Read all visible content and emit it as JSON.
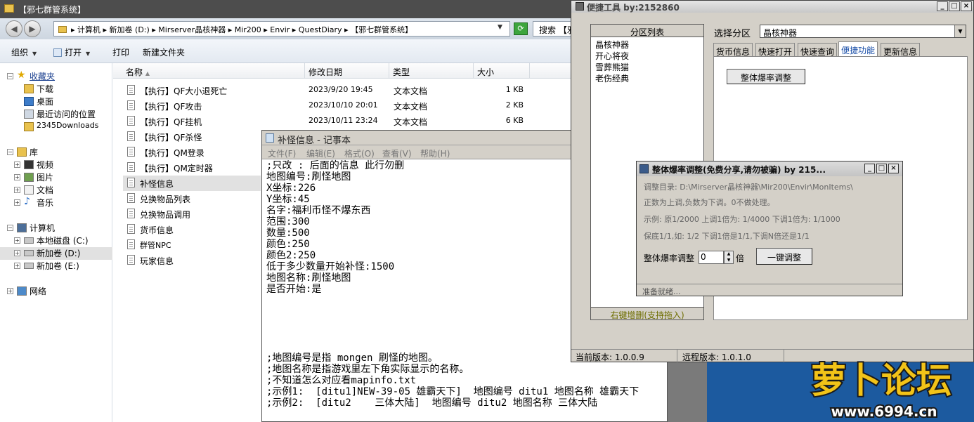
{
  "explorer": {
    "title": "【邪七群管系统】",
    "address": "▸ 计算机 ▸ 新加卷 (D:) ▸ Mirserver晶核神器 ▸ Mir200 ▸ Envir ▸ QuestDiary ▸ 【邪七群管系统】",
    "search_placeholder": "搜索 【邪",
    "toolbar": {
      "organize": "组织",
      "open": "打开",
      "print": "打印",
      "new_folder": "新建文件夹"
    },
    "nav": {
      "favorites": "收藏夹",
      "downloads": "下载",
      "desktop": "桌面",
      "recent": "最近访问的位置",
      "d2345": "2345Downloads",
      "library": "库",
      "video": "视频",
      "pictures": "图片",
      "documents": "文档",
      "music": "音乐",
      "computer": "计算机",
      "disk_c": "本地磁盘 (C:)",
      "disk_d": "新加卷 (D:)",
      "disk_e": "新加卷 (E:)",
      "network": "网络"
    },
    "columns": {
      "name": "名称",
      "date": "修改日期",
      "type": "类型",
      "size": "大小"
    },
    "files": [
      {
        "name": "【执行】QF大小退死亡",
        "date": "2023/9/20 19:45",
        "type": "文本文档",
        "size": "1 KB"
      },
      {
        "name": "【执行】QF攻击",
        "date": "2023/10/10 20:01",
        "type": "文本文档",
        "size": "2 KB"
      },
      {
        "name": "【执行】QF挂机",
        "date": "2023/10/11 23:24",
        "type": "文本文档",
        "size": "6 KB"
      },
      {
        "name": "【执行】QF杀怪",
        "date": "",
        "type": "",
        "size": ""
      },
      {
        "name": "【执行】QM登录",
        "date": "",
        "type": "",
        "size": ""
      },
      {
        "name": "【执行】QM定时器",
        "date": "",
        "type": "",
        "size": ""
      },
      {
        "name": "补怪信息",
        "date": "",
        "type": "",
        "size": ""
      },
      {
        "name": "兑换物品列表",
        "date": "",
        "type": "",
        "size": ""
      },
      {
        "name": "兑换物品调用",
        "date": "",
        "type": "",
        "size": ""
      },
      {
        "name": "货币信息",
        "date": "",
        "type": "",
        "size": ""
      },
      {
        "name": "群管NPC",
        "date": "",
        "type": "",
        "size": ""
      },
      {
        "name": "玩家信息",
        "date": "",
        "type": "",
        "size": ""
      }
    ]
  },
  "notepad": {
    "title": "补怪信息 - 记事本",
    "menu": [
      "文件(F)",
      "编辑(E)",
      "格式(O)",
      "查看(V)",
      "帮助(H)"
    ],
    "lines": [
      ";只改 : 后面的信息 此行勿删",
      "地图编号:刷怪地图",
      "X坐标:226",
      "Y坐标:45",
      "名字:福利币怪不爆东西",
      "范围:300",
      "数量:500",
      "颜色:250",
      "颜色2:250",
      "低于多少数量开始补怪:1500",
      "地图名称:刷怪地图",
      "是否开始:是"
    ],
    "notes": [
      ";地图编号是指 mongen 刷怪的地图。",
      ";地图名称是指游戏里左下角实际显示的名称。",
      ";不知道怎么对应看mapinfo.txt",
      ";示例1:  [ditu1]NEW-39-05 雄霸天下]  地图编号 ditu1 地图名称 雄霸天下",
      ";示例2:  [ditu2    三体大陆]  地图编号 ditu2 地图名称 三体大陆"
    ]
  },
  "tool": {
    "title": "便捷工具  by:2152860",
    "partition_header": "分区列表",
    "partitions": [
      "晶核神器",
      "开心将夜",
      "雪葬熊猫",
      "老伤经典"
    ],
    "partition_footer": "右键增删(支持拖入)",
    "select_label": "选择分区",
    "select_value": "晶核神器",
    "tabs": [
      "货币信息",
      "快速打开",
      "快速查询",
      "便捷功能",
      "更新信息"
    ],
    "active_tab": "便捷功能",
    "overall_button": "整体爆率调整",
    "current_version": "当前版本: 1.0.0.9",
    "remote_version": "远程版本: 1.0.1.0"
  },
  "dialog": {
    "title": "整体爆率调整(免费分享,请勿被骗)   by 215...",
    "dir_line": "调整目录: D:\\Mirserver晶核神器\\Mir200\\Envir\\MonItems\\",
    "hint1": "正数为上调,负数为下调。0不做处理。",
    "hint2": "示例: 原1/2000 上调1倍为: 1/4000 下调1倍为: 1/1000",
    "hint3": "保底1/1,如: 1/2 下调1倍是1/1,下调N倍还是1/1",
    "multiplier_label": "整体爆率调整",
    "multiplier_value": "0",
    "unit": "倍",
    "apply_button": "一键调整",
    "status": "准备就绪..."
  },
  "watermark": {
    "brand": "萝卜论坛",
    "url": "www.6994.cn"
  }
}
